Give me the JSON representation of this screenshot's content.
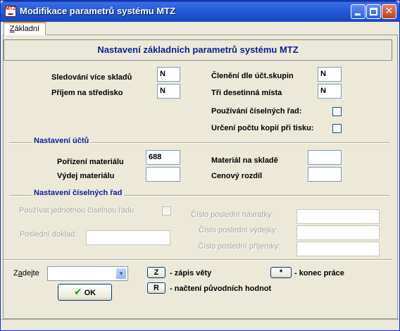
{
  "window": {
    "title": "Modifikace parametrů systému MTZ",
    "icon": "mtz-app-icon",
    "buttons": {
      "minimize": "minimize-icon",
      "maximize": "maximize-icon",
      "close": "close-icon"
    },
    "colors": {
      "titlebar": "#2a5ed8",
      "accent": "#0a1e9a",
      "face": "#ece9d8"
    }
  },
  "tabs": [
    {
      "label": "Základní",
      "accel": "Z",
      "rest": "ákladní",
      "active": true
    }
  ],
  "header": {
    "title": "Nastavení základních parametrů systému MTZ"
  },
  "general": {
    "multi_stock_label": "Sledování více skladů",
    "multi_stock_value": "N",
    "receipt_center_label": "Příjem na středisko",
    "receipt_center_value": "N",
    "account_groups_label": "Členění dle účt.skupin",
    "account_groups_value": "N",
    "three_decimals_label": "Tři desetinná místa",
    "three_decimals_value": "N",
    "numeric_series_label": "Používání číselných řad:",
    "numeric_series_checked": false,
    "copies_label": "Určení počtu kopií při tisku:",
    "copies_checked": false
  },
  "accounts": {
    "section_title": "Nastavení účtů",
    "acquisition_label": "Pořízení materiálu",
    "acquisition_value": "688",
    "issue_label": "Výdej materiálu",
    "issue_value": "",
    "stock_label": "Materiál na skladě",
    "stock_value": "",
    "price_diff_label": "Cenový rozdíl",
    "price_diff_value": ""
  },
  "numbering": {
    "section_title": "Nastavení číselných řad",
    "single_series_label": "Používat jednotnou číselnou řadu",
    "single_series_checked": false,
    "last_doc_label": "Poslední doklad:",
    "last_doc_value": "",
    "last_return_label": "Číslo poslední návratky:",
    "last_return_value": "",
    "last_issue_label": "Číslo poslední výdejky:",
    "last_issue_value": "",
    "last_receipt_label": "Číslo poslední příjemky:",
    "last_receipt_value": ""
  },
  "footer": {
    "enter_label": "Zadejte",
    "enter_accel": "a",
    "enter_value": "",
    "ok_label": "OK",
    "ok_icon": "checkmark-icon",
    "z_key": "Z",
    "z_desc": "- zápis věty",
    "r_key": "R",
    "r_desc": "- načtení původních hodnot",
    "star_key": "*",
    "star_desc": "- konec práce"
  }
}
